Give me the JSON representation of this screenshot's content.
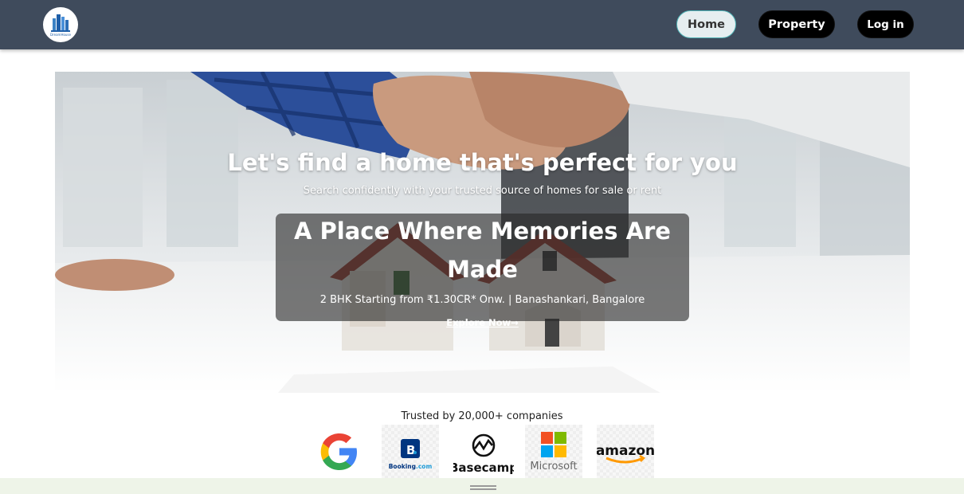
{
  "header": {
    "logo_text": "DreamHouse",
    "nav": {
      "home": "Home",
      "property": "Property",
      "login": "Log in"
    }
  },
  "hero": {
    "title": "Let's find a home that's perfect for you",
    "subtitle": "Search confidently with your trusted source of homes for sale or rent",
    "promo": {
      "title": "A Place Where Memories Are Made",
      "info": "2 BHK Starting from ₹1.30CR* Onw. | Banashankari, Bangalore",
      "link": "Explore Now→"
    }
  },
  "trusted": {
    "label": "Trusted by 20,000+ companies",
    "companies": [
      {
        "name": "Google",
        "icon": "google-logo"
      },
      {
        "name": "Booking.com",
        "icon": "booking-logo"
      },
      {
        "name": "Basecamp",
        "icon": "basecamp-logo"
      },
      {
        "name": "Microsoft",
        "icon": "microsoft-logo"
      },
      {
        "name": "amazon",
        "icon": "amazon-logo"
      }
    ]
  },
  "colors": {
    "header_bg": "#3f4b5c",
    "home_btn_bg": "#e6eef0",
    "home_btn_border": "#4fb3b6",
    "dark_btn_bg": "#000000",
    "footer_bg": "#eef4e8"
  }
}
